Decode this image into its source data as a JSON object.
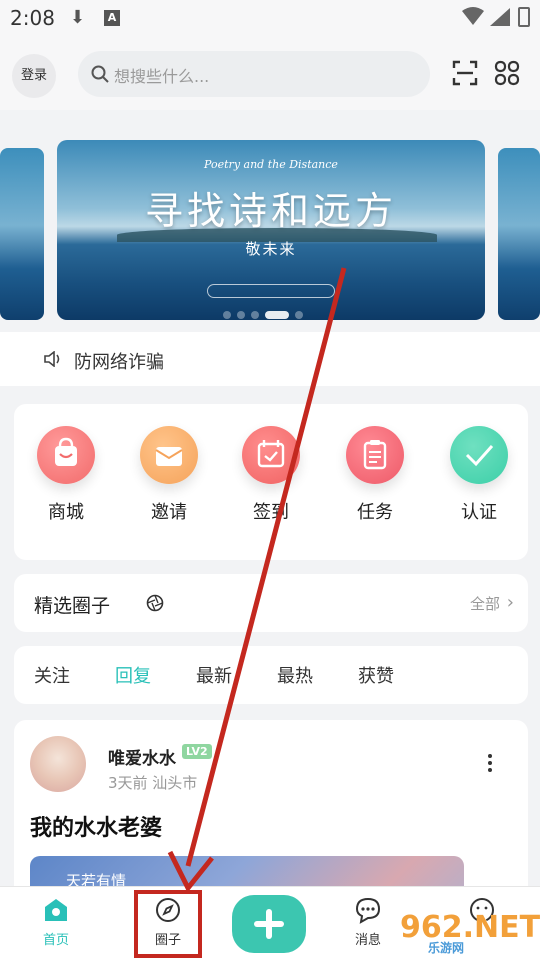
{
  "status_bar": {
    "time": "2:08"
  },
  "header": {
    "login_label": "登录",
    "search_placeholder": "想搜些什么..."
  },
  "banner": {
    "subtitle": "Poetry and the Distance",
    "title": "寻找诗和远方",
    "slogan": "敬未来",
    "slide_count": 5,
    "active_slide": 3
  },
  "notice": {
    "text": "防网络诈骗"
  },
  "shortcuts": [
    {
      "label": "商城",
      "icon": "shop-bag-icon",
      "color": "#f26b6b"
    },
    {
      "label": "邀请",
      "icon": "invite-envelope-icon",
      "color": "#f5a35b"
    },
    {
      "label": "签到",
      "icon": "checkin-calendar-icon",
      "color": "#f06262"
    },
    {
      "label": "任务",
      "icon": "task-clipboard-icon",
      "color": "#ee5a68"
    },
    {
      "label": "认证",
      "icon": "verify-check-icon",
      "color": "#3ccfa8"
    }
  ],
  "circles": {
    "title": "精选圈子",
    "all_label": "全部"
  },
  "tabs": [
    {
      "label": "关注",
      "active": false
    },
    {
      "label": "回复",
      "active": true
    },
    {
      "label": "最新",
      "active": false
    },
    {
      "label": "最热",
      "active": false
    },
    {
      "label": "获赞",
      "active": false
    }
  ],
  "post": {
    "username": "唯爱水水",
    "level": "LV2",
    "meta": "3天前 汕头市",
    "title": "我的水水老婆",
    "image_text": "天若有情"
  },
  "bottom_nav": {
    "home": "首页",
    "circle": "圈子",
    "messages": "消息",
    "accent": "#29c0b8"
  },
  "watermark": {
    "brand": "962.NET",
    "sub": "乐游网"
  },
  "annotation_color": "#c4281f"
}
